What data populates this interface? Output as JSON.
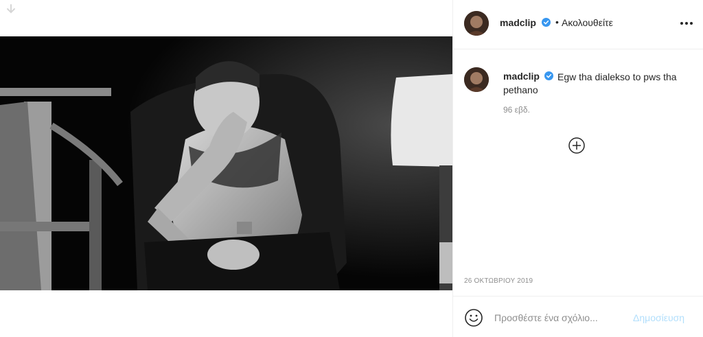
{
  "post": {
    "username": "madclip",
    "follow_state": "Ακολουθείτε",
    "dot": "•",
    "caption": "Egw tha dialekso to pws tha pethano",
    "age": "96 εβδ.",
    "date": "26 ΟΚΤΩΒΡΙΟΥ 2019"
  },
  "comment": {
    "placeholder": "Προσθέστε ένα σχόλιο...",
    "post_label": "Δημοσίευση"
  },
  "icons": {
    "verified": "verified-badge-icon",
    "more": "more-options-icon",
    "load_more": "plus-circle-icon",
    "emoji": "emoji-icon",
    "corner": "save-arrow-icon"
  },
  "colors": {
    "verified": "#3897f0",
    "post_disabled": "#b2dffc",
    "muted_text": "#8e8e8e"
  }
}
